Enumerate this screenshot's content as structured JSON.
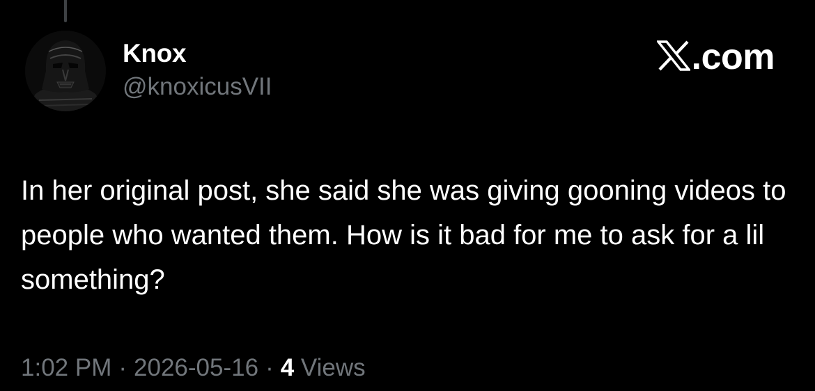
{
  "tweet": {
    "author": {
      "display_name": "Knox",
      "handle": "@knoxicusVII",
      "avatar_icon": "darth-vader-avatar"
    },
    "source": {
      "logo_icon": "x-logo-icon",
      "domain": ".com"
    },
    "text": "In her original post, she said she was giving gooning videos to people who wanted them. How is it bad for me to ask for a lil something?",
    "time": "1:02 PM",
    "separator": "·",
    "date": "2026-05-16",
    "views_count": "4",
    "views_label": "Views"
  },
  "colors": {
    "background": "#000000",
    "primary_text": "#ffffff",
    "secondary_text": "#71767b",
    "thread_line": "#3e4144"
  }
}
